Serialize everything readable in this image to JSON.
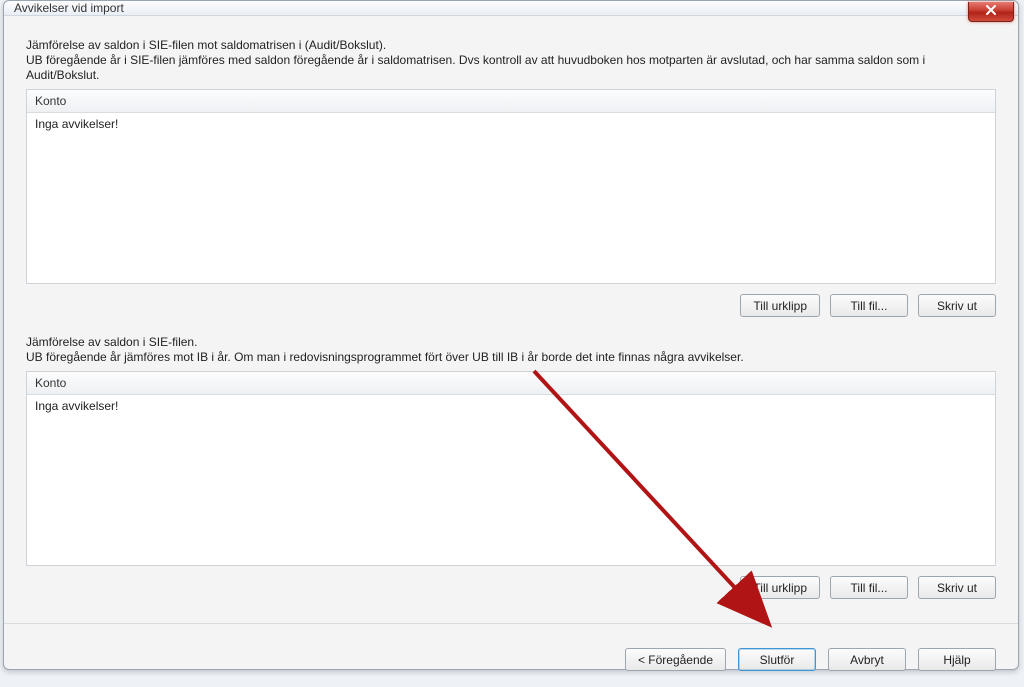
{
  "window": {
    "title": "Avvikelser vid import"
  },
  "section1": {
    "desc_line1": "Jämförelse av saldon i SIE-filen mot saldomatrisen i (Audit/Bokslut).",
    "desc_line2": "UB föregående år i SIE-filen jämföres med saldon föregående år i saldomatrisen. Dvs kontroll av att huvudboken hos motparten är avslutad, och har samma saldon som i Audit/Bokslut.",
    "header": "Konto",
    "body": "Inga avvikelser!",
    "btn_clipboard": "Till urklipp",
    "btn_file": "Till fil...",
    "btn_print": "Skriv ut"
  },
  "section2": {
    "desc_line1": "Jämförelse av saldon i SIE-filen.",
    "desc_line2": "UB föregående år jämföres mot IB i år. Om man i redovisningsprogrammet fört över UB till IB i år borde det inte finnas några avvikelser.",
    "header": "Konto",
    "body": "Inga avvikelser!",
    "btn_clipboard": "Till urklipp",
    "btn_file": "Till fil...",
    "btn_print": "Skriv ut"
  },
  "footer": {
    "back": "< Föregående",
    "finish": "Slutför",
    "cancel": "Avbryt",
    "help": "Hjälp"
  }
}
